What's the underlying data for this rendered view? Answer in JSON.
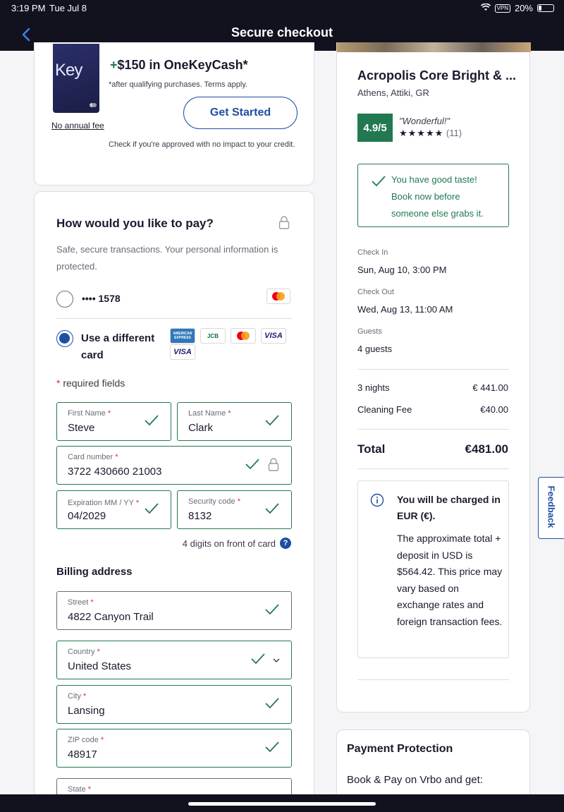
{
  "status_bar": {
    "time": "3:19 PM",
    "date": "Tue Jul 8",
    "vpn": "VPN",
    "battery": "20%"
  },
  "nav": {
    "title": "Secure checkout"
  },
  "promo": {
    "card_brand": "Key",
    "cashback_prefix": "+",
    "cashback": "$150 in OneKeyCash*",
    "terms": "*after qualifying purchases. Terms apply.",
    "cta": "Get Started",
    "annual_fee": "No annual fee",
    "approval_note": "Check if you're approved with no impact to your credit."
  },
  "payment": {
    "heading": "How would you like to pay?",
    "subtext": "Safe, secure transactions. Your personal information is protected.",
    "saved_card": "•••• 1578",
    "different_card": "Use a different card",
    "logos": [
      "AMERICAN EXPRESS",
      "JCB",
      "mastercard",
      "VISA",
      "VISA"
    ],
    "required_asterisk": "*",
    "required_note": "required fields",
    "fields": {
      "first_name": {
        "label": "First Name",
        "value": "Steve"
      },
      "last_name": {
        "label": "Last Name",
        "value": "Clark"
      },
      "card_number": {
        "label": "Card number",
        "value": "3722 430660 21003"
      },
      "expiration": {
        "label": "Expiration MM / YY",
        "value": "04/2029"
      },
      "security_code": {
        "label": "Security code",
        "value": "8132"
      }
    },
    "cvv_hint": "4 digits on front of card",
    "cvv_help": "?"
  },
  "billing": {
    "heading": "Billing address",
    "street": {
      "label": "Street",
      "value": "4822 Canyon Trail"
    },
    "country": {
      "label": "Country",
      "value": "United States"
    },
    "city": {
      "label": "City",
      "value": "Lansing"
    },
    "zip": {
      "label": "ZIP code",
      "value": "48917"
    },
    "state": {
      "label": "State",
      "value": ""
    }
  },
  "summary": {
    "property": "Acropolis Core Bright & ...",
    "location": "Athens, Attiki, GR",
    "rating": "4.9/5",
    "rating_text": "\"Wonderful!\"",
    "stars": "★★★★★",
    "reviews": "(11)",
    "taste_note": "You have good taste! Book now before someone else grabs it.",
    "checkin_label": "Check In",
    "checkin": "Sun, Aug 10, 3:00 PM",
    "checkout_label": "Check Out",
    "checkout": "Wed, Aug 13, 11:00 AM",
    "guests_label": "Guests",
    "guests": "4 guests",
    "nights_label": "3 nights",
    "nights_price": "€ 441.00",
    "cleaning_label": "Cleaning Fee",
    "cleaning_price": "€40.00",
    "total_label": "Total",
    "total": "€481.00",
    "charge_title": "You will be charged in EUR (€).",
    "charge_body": "The approximate total + deposit in USD is $564.42. This price may vary based on exchange rates and foreign transaction fees."
  },
  "protection": {
    "heading": "Payment Protection",
    "body": "Book & Pay on Vrbo and get:"
  },
  "feedback": "Feedback",
  "colors": {
    "accent_green": "#227950",
    "brand_blue": "#1f4ea3",
    "nav_dark": "#12121f"
  }
}
